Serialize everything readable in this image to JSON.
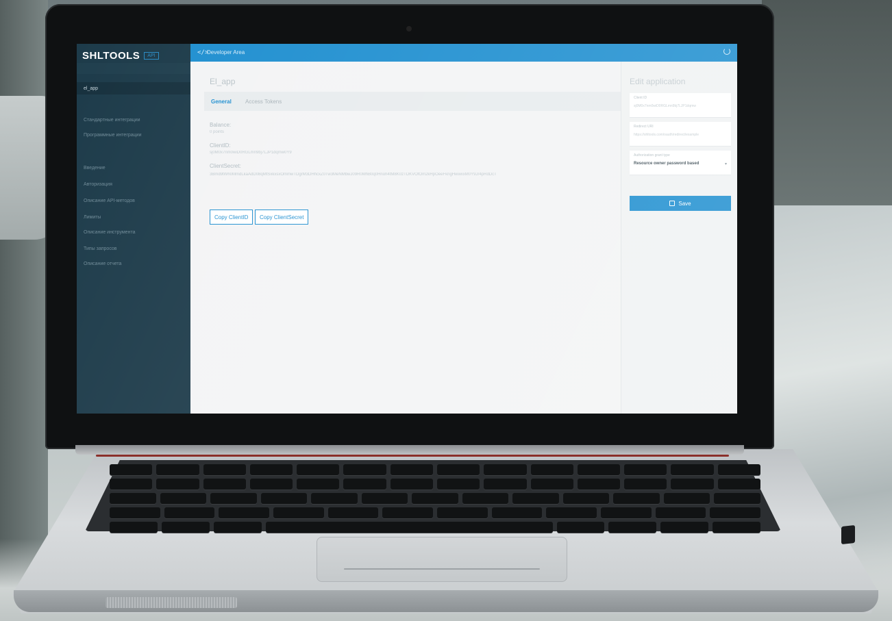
{
  "app": {
    "logo": "SHLTOOLS",
    "logo_badge": "API"
  },
  "topbar": {
    "code_icon": "</>",
    "title": "Developer Area"
  },
  "sidebar": {
    "items": [
      {
        "label": "el_app"
      },
      {
        "label": "Стандартные интеграции"
      },
      {
        "label": "Программные интеграции"
      },
      {
        "label": "Введение"
      },
      {
        "label": "Авторизация"
      },
      {
        "label": "Описание API-методов"
      },
      {
        "label": "Лимиты"
      },
      {
        "label": "Описание инструмента"
      },
      {
        "label": "Типы запросов"
      },
      {
        "label": "Описание отчета"
      }
    ]
  },
  "main": {
    "app_title": "El_app",
    "tabs": [
      {
        "label": "General"
      },
      {
        "label": "Access Tokens"
      }
    ],
    "balance_label": "Balance:",
    "balance_value": "0 points",
    "client_id_label": "ClientID:",
    "client_id_value": "sj0M0x7nm0wiD0RGLmn9bj7LJP1dqmw0Y9",
    "client_secret_label": "ClientSecret:",
    "client_secret_value": "3Bmd9tWh0MmdLkaAdD08qMtSxkxsxOmmwTDgrM3DHhcxZ0Tw3MeNMbwJ09R0MhB0q0Hnoh4tM8K0zTDKVOfOm2kHpOeeFkngHwwxxM0Y9Jr4pRdDcT",
    "copy_client_id_button": "Copy ClientID",
    "copy_client_secret_button": "Copy ClientSecret"
  },
  "panel": {
    "title": "Edit application",
    "client_id_field_label": "Client ID",
    "client_id_field_value": "sj0M0x7nm0wiD0RGLmn9bj7LJP1dqmw",
    "redirect_field_label": "Redirect URI",
    "redirect_field_value": "https://shltools.com/oauth/redirect/example",
    "grant_type_field_label": "Authorization grant type",
    "grant_type_value": "Resource owner password based",
    "save_button": "Save"
  },
  "colors": {
    "accent": "#1f8fd0",
    "sidebar": "#1d3b4a"
  }
}
